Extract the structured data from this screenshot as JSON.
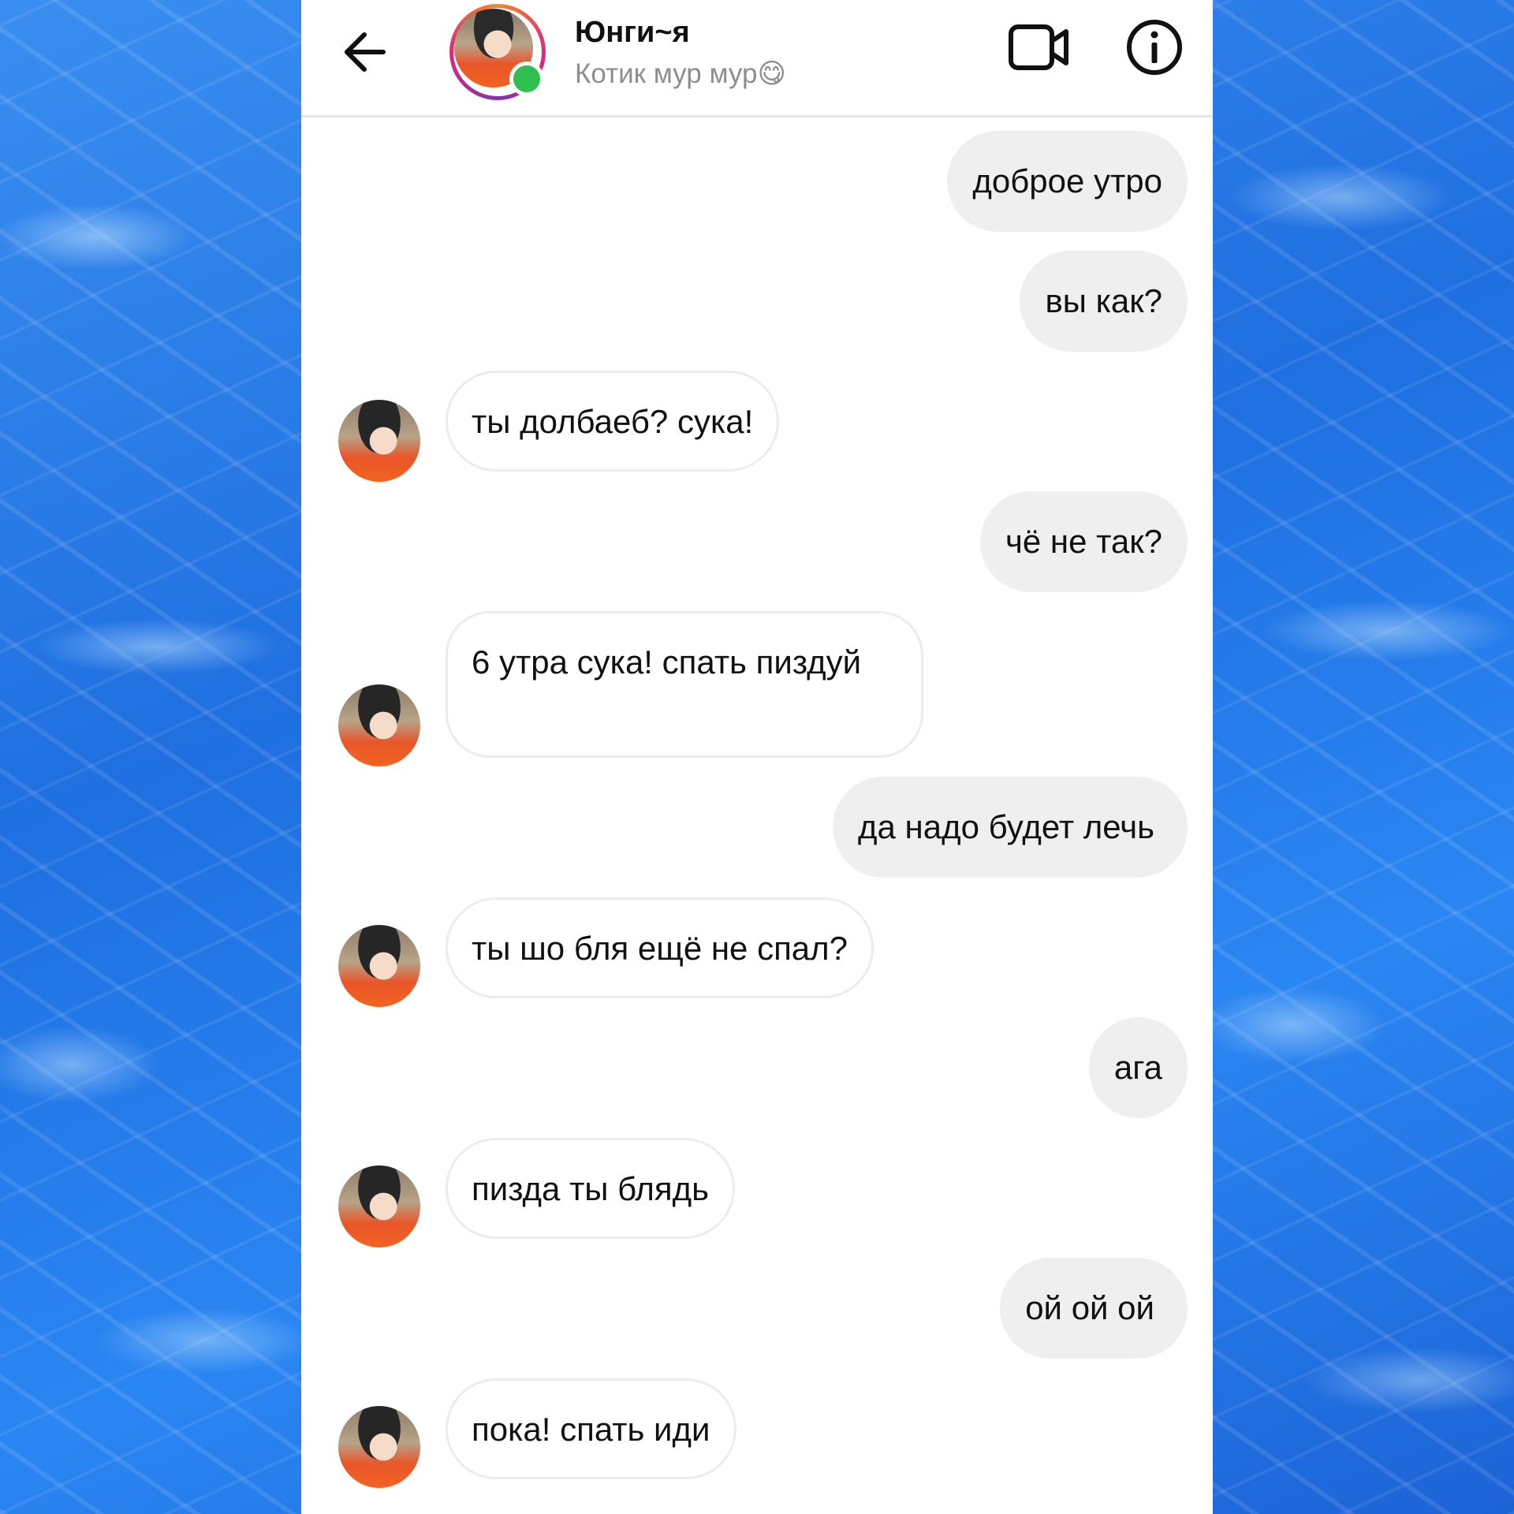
{
  "header": {
    "name": "Юнги~я",
    "status": "Котик мур мур😋"
  },
  "icons": {
    "back": "arrow-left-icon",
    "video": "video-camera-icon",
    "info": "info-icon"
  },
  "colors": {
    "online": "#2fbf4f",
    "outgoing_bubble": "#efefef",
    "incoming_border": "#ececec"
  },
  "messages": [
    {
      "from": "me",
      "text": "доброе утро"
    },
    {
      "from": "me",
      "text": "вы как?"
    },
    {
      "from": "them",
      "text": "ты долбаеб? сука!"
    },
    {
      "from": "me",
      "text": "чё не так?"
    },
    {
      "from": "them",
      "text": "6 утра сука! спать пиздуй"
    },
    {
      "from": "me",
      "text": "да надо будет лечь"
    },
    {
      "from": "them",
      "text": "ты шо бля ещё не спал?"
    },
    {
      "from": "me",
      "text": "ага"
    },
    {
      "from": "them",
      "text": "пизда ты блядь"
    },
    {
      "from": "me",
      "text": "ой ой ой"
    },
    {
      "from": "them",
      "text": "пока! спать иди"
    }
  ]
}
